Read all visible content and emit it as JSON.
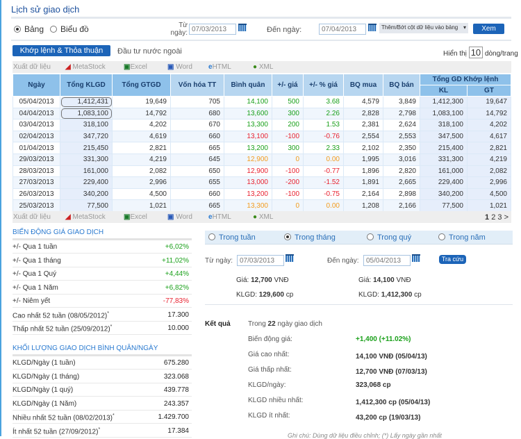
{
  "title": "Lịch sử giao dịch",
  "view": {
    "table": "Bảng",
    "chart": "Biểu đồ",
    "selected": "table"
  },
  "filter": {
    "from_label": "Từ ngày:",
    "from": "07/03/2013",
    "to_label": "Đến ngày:",
    "to": "07/04/2013",
    "columns_select": "Thêm/Bớt cột dữ liệu vào bảng",
    "view_btn": "Xem"
  },
  "tabs": {
    "active": "Khớp lệnh & Thỏa thuận",
    "other": "Đầu tư nước ngoài"
  },
  "paging": {
    "show": "Hiển thị",
    "rows": "10",
    "per_page": "dòng/trang",
    "pages": [
      "1",
      "2",
      "3",
      ">"
    ]
  },
  "export": {
    "label": "Xuất dữ liệu",
    "items": [
      "MetaStock",
      "Excel",
      "Word",
      "HTML",
      "XML"
    ]
  },
  "table": {
    "headers": [
      "Ngày",
      "Tổng KLGD",
      "Tổng GTGD",
      "Vốn hóa TT",
      "Bình quân",
      "+/- giá",
      "+/- % giá",
      "BQ mua",
      "BQ bán"
    ],
    "group_header": "Tổng GD Khớp lệnh",
    "sub_headers": [
      "KL",
      "GT"
    ],
    "rows": [
      [
        "05/04/2013",
        "1,412,431",
        "19,649",
        "705",
        "14,100",
        "500",
        "3.68",
        "4,579",
        "3,849",
        "1,412,300",
        "19,647",
        "g"
      ],
      [
        "04/04/2013",
        "1,083,100",
        "14,792",
        "680",
        "13,600",
        "300",
        "2.26",
        "2,828",
        "2,798",
        "1,083,100",
        "14,792",
        "g"
      ],
      [
        "03/04/2013",
        "318,100",
        "4,202",
        "670",
        "13,300",
        "200",
        "1.53",
        "2,381",
        "2,624",
        "318,100",
        "4,202",
        "g"
      ],
      [
        "02/04/2013",
        "347,720",
        "4,619",
        "660",
        "13,100",
        "-100",
        "-0.76",
        "2,554",
        "2,553",
        "347,500",
        "4,617",
        "r"
      ],
      [
        "01/04/2013",
        "215,450",
        "2,821",
        "665",
        "13,200",
        "300",
        "2.33",
        "2,102",
        "2,350",
        "215,400",
        "2,821",
        "g"
      ],
      [
        "29/03/2013",
        "331,300",
        "4,219",
        "645",
        "12,900",
        "0",
        "0.00",
        "1,995",
        "3,016",
        "331,300",
        "4,219",
        "o"
      ],
      [
        "28/03/2013",
        "161,000",
        "2,082",
        "650",
        "12,900",
        "-100",
        "-0.77",
        "1,896",
        "2,820",
        "161,000",
        "2,082",
        "r"
      ],
      [
        "27/03/2013",
        "229,400",
        "2,996",
        "655",
        "13,000",
        "-200",
        "-1.52",
        "1,891",
        "2,665",
        "229,400",
        "2,996",
        "r"
      ],
      [
        "26/03/2013",
        "340,200",
        "4,500",
        "660",
        "13,200",
        "-100",
        "-0.75",
        "2,164",
        "2,898",
        "340,200",
        "4,500",
        "r"
      ],
      [
        "25/03/2013",
        "77,500",
        "1,021",
        "665",
        "13,300",
        "0",
        "0.00",
        "1,208",
        "2,166",
        "77,500",
        "1,021",
        "o"
      ]
    ]
  },
  "price_change": {
    "title": "BIẾN ĐỘNG GIÁ GIAO DỊCH",
    "rows": [
      {
        "k": "+/- Qua 1 tuần",
        "v": "+6,02%",
        "c": "g"
      },
      {
        "k": "+/- Qua 1 tháng",
        "v": "+11,02%",
        "c": "g"
      },
      {
        "k": "+/- Qua 1 Quý",
        "v": "+4,44%",
        "c": "g"
      },
      {
        "k": "+/- Qua 1 Năm",
        "v": "+6,82%",
        "c": "g"
      },
      {
        "k": "+/- Niêm yết",
        "v": "-77,83%",
        "c": "r"
      },
      {
        "k": "Cao nhất 52 tuần (08/05/2012)",
        "v": "17.300",
        "c": "b",
        "s": "*"
      },
      {
        "k": "Thấp nhất 52 tuần (25/09/2012)",
        "v": "10.000",
        "c": "b",
        "s": "*"
      }
    ]
  },
  "volume": {
    "title": "KHỐI LƯỢNG GIAO DỊCH BÌNH QUÂN/NGÀY",
    "rows": [
      {
        "k": "KLGD/Ngày (1 tuần)",
        "v": "675.280"
      },
      {
        "k": "KLGD/Ngày (1 tháng)",
        "v": "323.068"
      },
      {
        "k": "KLGD/Ngày (1 quý)",
        "v": "439.778"
      },
      {
        "k": "KLGD/Ngày (1 Năm)",
        "v": "243.357"
      },
      {
        "k": "Nhiều nhất 52 tuần (08/02/2013)",
        "v": "1.429.700",
        "s": "*"
      },
      {
        "k": "Ít nhất 52 tuần (27/09/2012)",
        "v": "17.384",
        "s": "*"
      }
    ]
  },
  "period": {
    "options": [
      "Trong tuần",
      "Trong tháng",
      "Trong quý",
      "Trong năm"
    ],
    "selected": 1,
    "from_label": "Từ ngày:",
    "from": "07/03/2013",
    "to_label": "Đến ngày:",
    "to": "05/04/2013",
    "search": "Tra cứu",
    "start": {
      "price_label": "Giá:",
      "price": "12,700",
      "price_unit": "VNĐ",
      "vol_label": "KLGD:",
      "vol": "129,600",
      "vol_unit": "cp"
    },
    "end": {
      "price_label": "Giá:",
      "price": "14,100",
      "price_unit": "VNĐ",
      "vol_label": "KLGD:",
      "vol": "1,412,300",
      "vol_unit": "cp"
    }
  },
  "result": {
    "label": "Kết quả",
    "days_pre": "Trong",
    "days": "22",
    "days_post": "ngày giao dịch",
    "rows": [
      {
        "k": "Biến động giá:",
        "v": "+1,400 (+11.02%)"
      },
      {
        "k": "Giá cao nhất:",
        "v": "14,100 VNĐ (05/04/13)"
      },
      {
        "k": "Giá thấp nhất:",
        "v": "12,700 VNĐ (07/03/13)"
      },
      {
        "k": "KLGD/ngày:",
        "v": "323,068 cp"
      },
      {
        "k": "KLGD nhiều nhất:",
        "v": "1,412,300 cp (05/04/13)"
      },
      {
        "k": "KLGD ít nhất:",
        "v": "43,200 cp (19/03/13)"
      }
    ],
    "note": "Ghi chú: Dùng dữ liệu điều chỉnh; (*) Lấy ngày gần nhất"
  }
}
